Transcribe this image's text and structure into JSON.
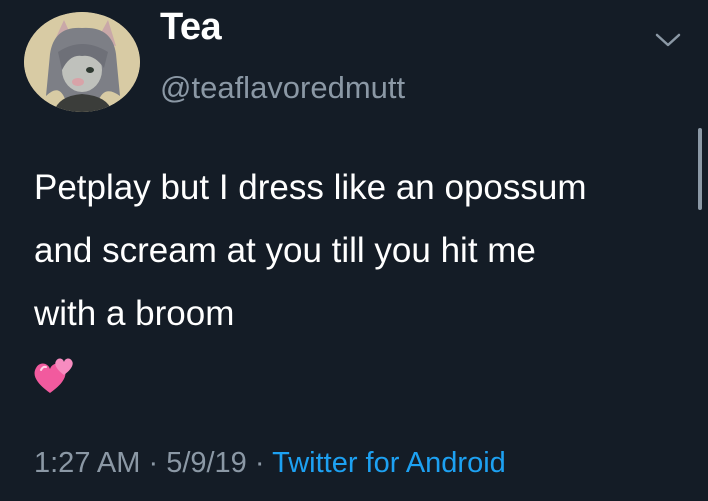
{
  "author": {
    "display_name": "Tea",
    "handle": "@teaflavoredmutt",
    "avatar_icon": "avatar-cartoon-character-icon"
  },
  "tweet": {
    "lines": [
      "Petplay but I dress like an opossum",
      "and scream at you till you hit me",
      "with a broom"
    ],
    "emoji": "💞"
  },
  "meta": {
    "time": "1:27 AM",
    "separator_1": " · ",
    "date": "5/9/19",
    "separator_2": " · ",
    "source": "Twitter for Android"
  },
  "colors": {
    "background": "#141c26",
    "text_primary": "#ffffff",
    "text_secondary": "#8b98a5",
    "accent": "#1da1f2"
  }
}
